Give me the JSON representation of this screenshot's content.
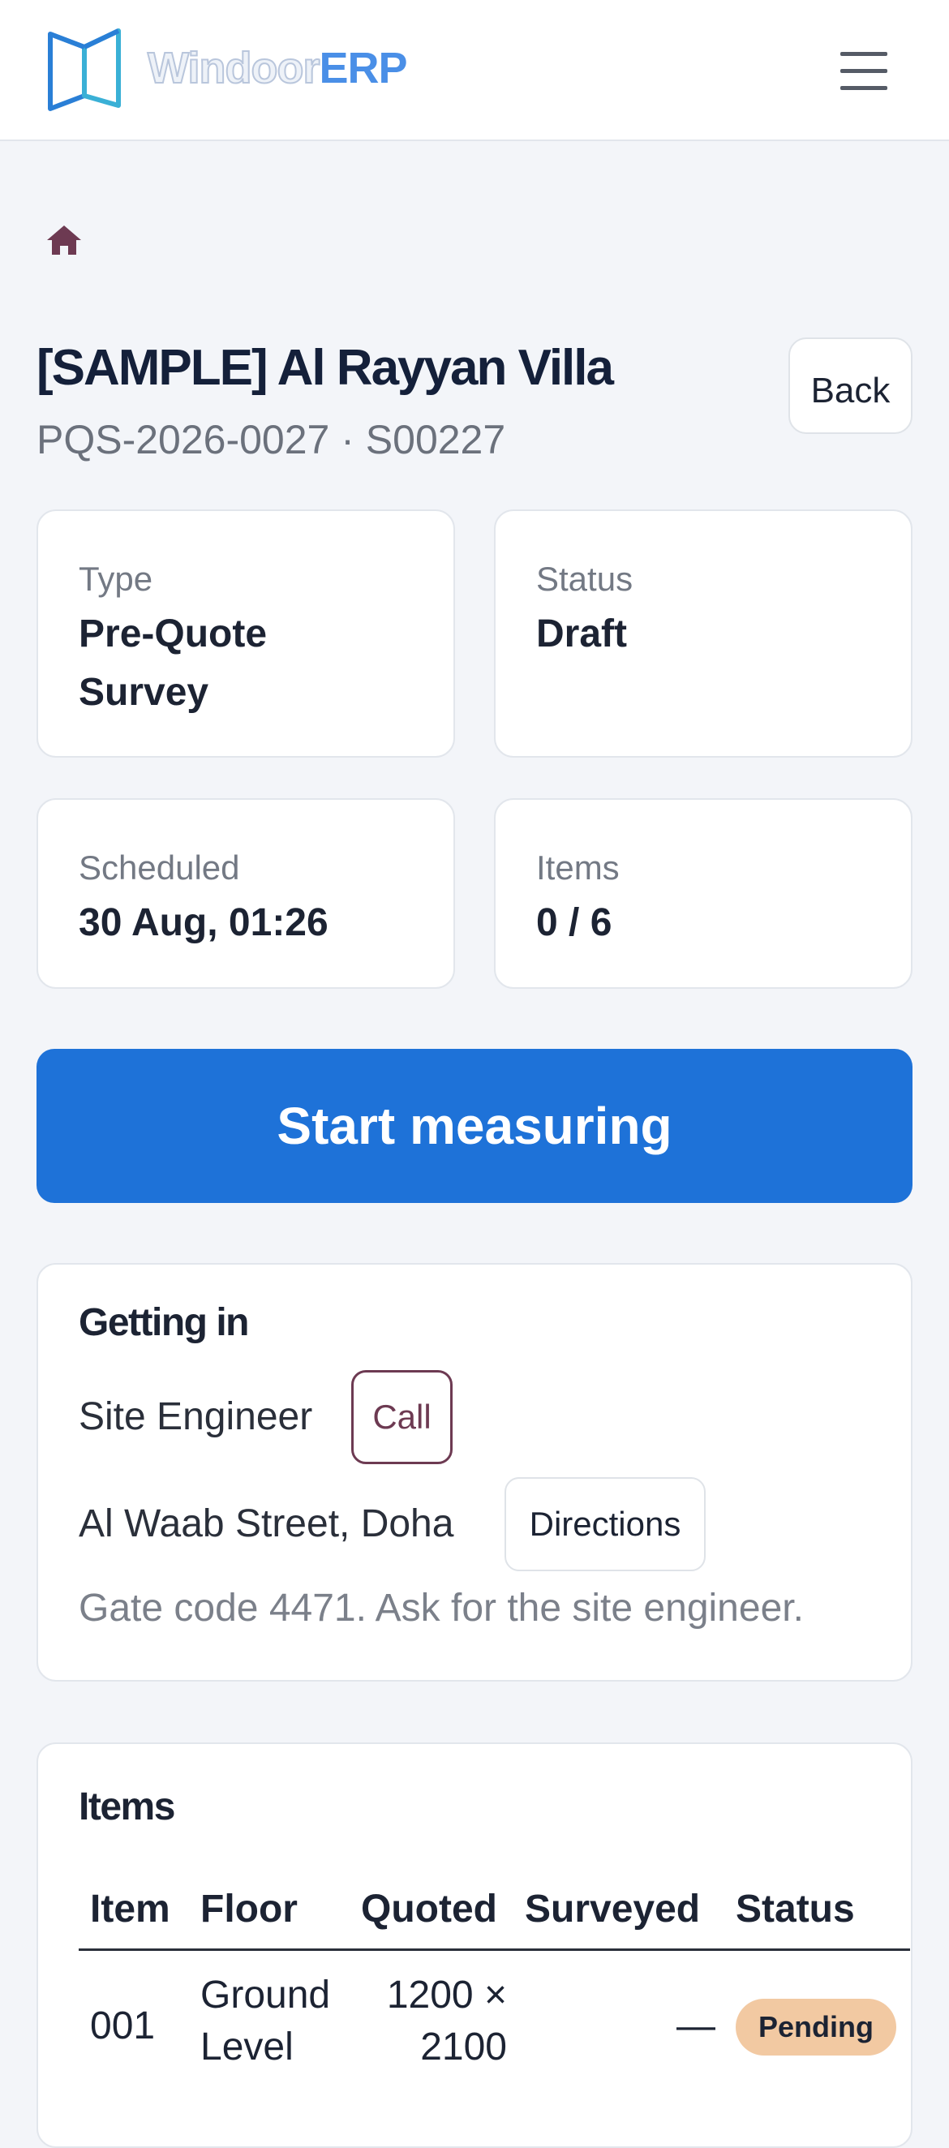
{
  "navbar": {
    "logo_word": "Windoor",
    "logo_accent": "ERP",
    "menu_icon": "hamburger-icon"
  },
  "breadcrumb": {
    "icon": "home-icon"
  },
  "header": {
    "title": "[SAMPLE] Al Rayyan Villa",
    "subtitle": "PQS-2026-0027 · S00227",
    "back_label": "Back"
  },
  "stats": [
    {
      "label": "Type",
      "value": "Pre-Quote Survey"
    },
    {
      "label": "Status",
      "value": "Draft"
    },
    {
      "label": "Scheduled",
      "value": "30 Aug, 01:26"
    },
    {
      "label": "Items",
      "value": "0 / 6"
    }
  ],
  "primary_action": {
    "label": "Start measuring"
  },
  "access": {
    "title": "Getting in",
    "contact": "Site Engineer",
    "call_label": "Call",
    "address": "Al Waab Street, Doha",
    "directions_label": "Directions",
    "note": "Gate code 4471. Ask for the site engineer."
  },
  "items": {
    "title": "Items",
    "columns": [
      "Item",
      "Floor",
      "Quoted",
      "Surveyed",
      "Status"
    ],
    "rows": [
      {
        "item": "001",
        "floor": "Ground Level",
        "quoted": "1200 × 2100",
        "surveyed": "—",
        "status": "Pending"
      }
    ]
  },
  "colors": {
    "primary": "#1e72d8",
    "brand_accent": "#4a8fe7",
    "call_accent": "#6d3a52",
    "pending_badge": "#f2c9a2",
    "background": "#f3f5f9"
  }
}
